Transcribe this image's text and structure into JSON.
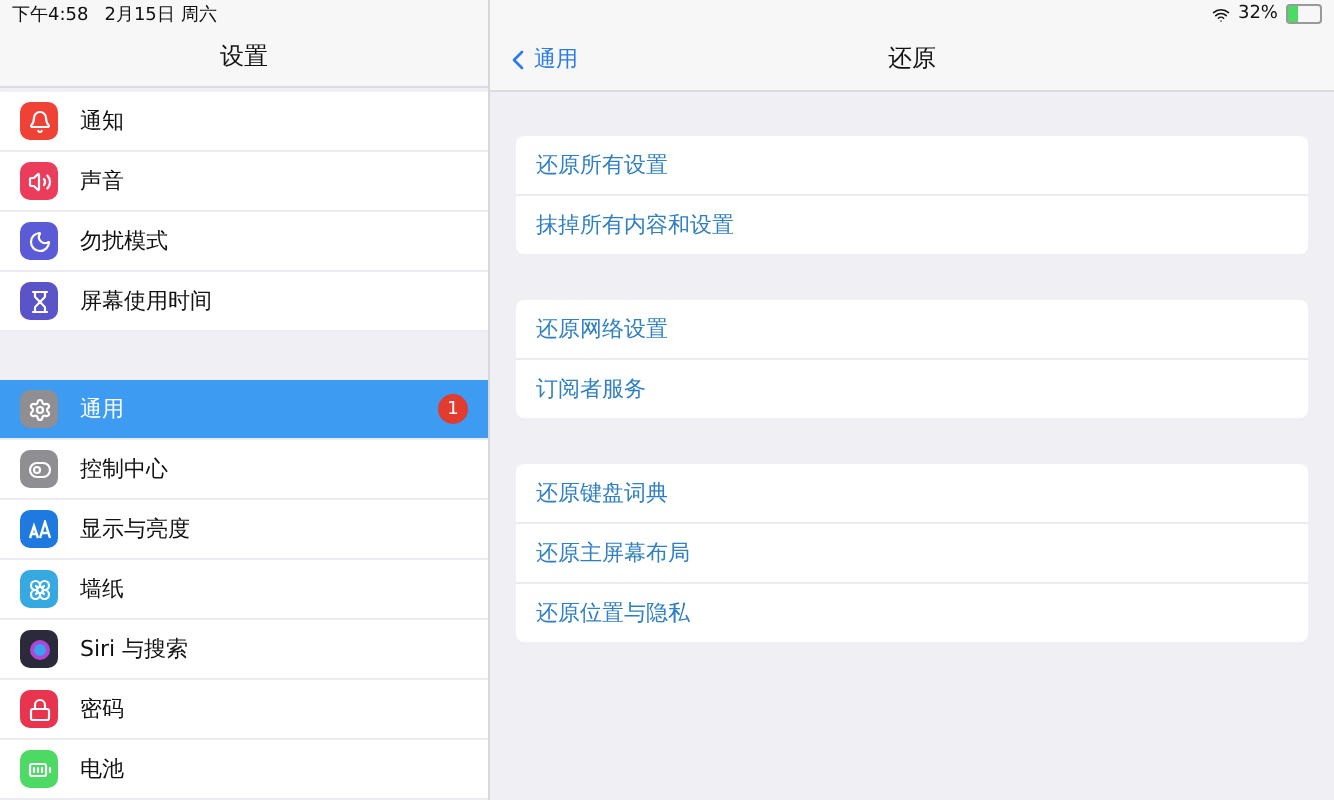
{
  "status_bar": {
    "time": "下午4:58",
    "date": "2月15日 周六",
    "battery": "32%"
  },
  "sidebar": {
    "title": "设置",
    "groups": [
      {
        "items": [
          {
            "label": "通知",
            "color": "#ef4136",
            "selected": false
          },
          {
            "label": "声音",
            "color": "#eb3d5b",
            "selected": false
          },
          {
            "label": "勿扰模式",
            "color": "#5b5bd6",
            "selected": false
          },
          {
            "label": "屏幕使用时间",
            "color": "#5b54c9",
            "selected": false
          }
        ]
      },
      {
        "items": [
          {
            "label": "通用",
            "color": "#8e8e93",
            "selected": true,
            "badge": "1"
          },
          {
            "label": "控制中心",
            "color": "#8e8e93",
            "selected": false
          },
          {
            "label": "显示与亮度",
            "color": "#1f7ae0",
            "selected": false
          },
          {
            "label": "墙纸",
            "color": "#35a9e0",
            "selected": false
          },
          {
            "label": "Siri 与搜索",
            "color": "#2a2a3a",
            "selected": false
          },
          {
            "label": "密码",
            "color": "#e8344f",
            "selected": false
          },
          {
            "label": "电池",
            "color": "#4cd964",
            "selected": false
          }
        ]
      }
    ]
  },
  "detail": {
    "back": "通用",
    "title": "还原",
    "groups": [
      [
        "还原所有设置",
        "抹掉所有内容和设置"
      ],
      [
        "还原网络设置",
        "订阅者服务"
      ],
      [
        "还原键盘词典",
        "还原主屏幕布局",
        "还原位置与隐私"
      ]
    ]
  }
}
